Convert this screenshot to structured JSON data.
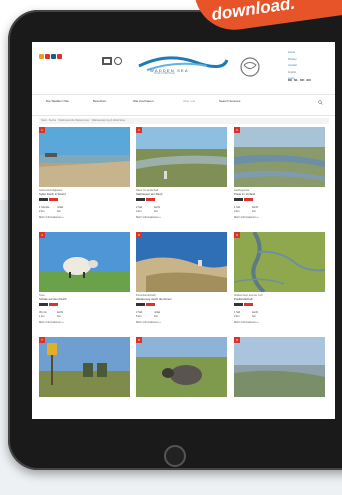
{
  "banner": {
    "text": "download."
  },
  "site": {
    "logo_text": "WADDEN SEA",
    "logo_sub": "WORLD HERITAGE",
    "header_links": [
      "Home",
      "Privacy",
      "Contact",
      "Imprint",
      "Login"
    ],
    "languages": [
      "DE",
      "NL",
      "DK",
      "EN"
    ]
  },
  "nav": {
    "items": [
      "Die Wadden Tide",
      "Besuchen",
      "Wie zuschauen",
      "Über uns",
      "Search Sources"
    ]
  },
  "breadcrumb": "Start · Suche · Weltnaturerbe Wattenmeer · Wattwanderung & Erlebnisse",
  "cards": [
    {
      "badge": "1",
      "category": "Sehenswürdigkeiten",
      "title": "Sylter Deich & Strand",
      "tags": [
        "#333333",
        "#d9342b"
      ],
      "stats": [
        "1 Stunde",
        "mittel",
        "2 km",
        "frei"
      ],
      "more": "Mehr Informationen »"
    },
    {
      "badge": "2",
      "category": "Natur & Landschaft",
      "title": "Salzwiesen am Rand",
      "tags": [
        "#333333",
        "#d9342b"
      ],
      "stats": [
        "2 Std.",
        "leicht",
        "4 km",
        "frei"
      ],
      "more": "Mehr Informationen »"
    },
    {
      "badge": "3",
      "category": "Ausflugsziele",
      "title": "Priele im Vorland",
      "tags": [
        "#333333",
        "#d9342b"
      ],
      "stats": [
        "1 Std.",
        "leicht",
        "3 km",
        "frei"
      ],
      "more": "Mehr Informationen »"
    },
    {
      "badge": "4",
      "category": "Tiere",
      "title": "Schafe auf dem Deich",
      "tags": [
        "#333333",
        "#d9342b"
      ],
      "stats": [
        "30 min",
        "leicht",
        "1 km",
        "frei"
      ],
      "more": "Mehr Informationen »"
    },
    {
      "badge": "5",
      "category": "Dünenlandschaft",
      "title": "Wanderung durch die Dünen",
      "tags": [
        "#333333",
        "#d9342b"
      ],
      "stats": [
        "2 Std.",
        "mittel",
        "5 km",
        "frei"
      ],
      "more": "Mehr Informationen »"
    },
    {
      "badge": "6",
      "category": "Wattenmeer aus der Luft",
      "title": "Priellandschaft",
      "tags": [
        "#333333",
        "#d9342b"
      ],
      "stats": [
        "1 Std.",
        "leicht",
        "2 km",
        "frei"
      ],
      "more": "Mehr Informationen »"
    },
    {
      "badge": "7",
      "category": "",
      "title": "",
      "tags": [],
      "stats": [],
      "more": ""
    },
    {
      "badge": "8",
      "category": "",
      "title": "",
      "tags": [],
      "stats": [],
      "more": ""
    },
    {
      "badge": "9",
      "category": "",
      "title": "",
      "tags": [],
      "stats": [],
      "more": ""
    }
  ]
}
